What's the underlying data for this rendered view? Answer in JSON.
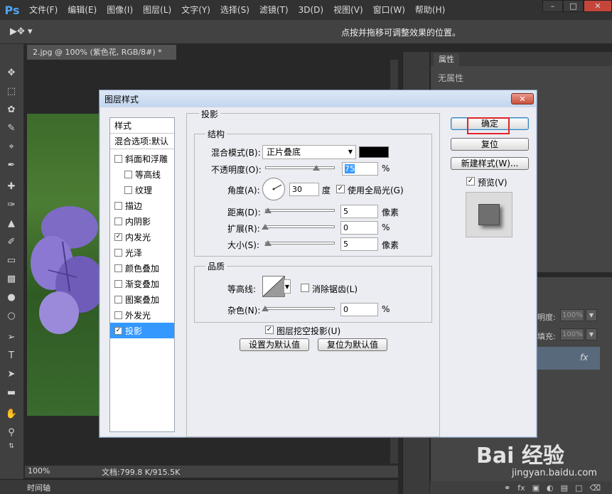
{
  "app": {
    "logo": "Ps"
  },
  "menu": [
    "文件(F)",
    "编辑(E)",
    "图像(I)",
    "图层(L)",
    "文字(Y)",
    "选择(S)",
    "滤镜(T)",
    "3D(D)",
    "视图(V)",
    "窗口(W)",
    "帮助(H)"
  ],
  "options_bar": {
    "hint": "点按并拖移可调整效果的位置。"
  },
  "document": {
    "tab_title": "2.jpg @ 100% (紫色花, RGB/8#) *",
    "zoom": "100%",
    "doc_size": "文档:799.8 K/915.5K",
    "timeline": "时间轴"
  },
  "properties_panel": {
    "tab": "属性",
    "empty_text": "无属性"
  },
  "layers_panel": {
    "opacity_label": "明度:",
    "opacity_value": "100%",
    "fill_label": "填充:",
    "fill_value": "100%",
    "fx_label": "fx"
  },
  "dialog": {
    "title": "图层样式",
    "style_list": [
      {
        "label": "样式",
        "type": "header"
      },
      {
        "label": "混合选项:默认",
        "type": "header"
      },
      {
        "label": "斜面和浮雕",
        "checked": false,
        "indent": false
      },
      {
        "label": "等高线",
        "checked": false,
        "indent": true
      },
      {
        "label": "纹理",
        "checked": false,
        "indent": true
      },
      {
        "label": "描边",
        "checked": false,
        "indent": false
      },
      {
        "label": "内阴影",
        "checked": false,
        "indent": false
      },
      {
        "label": "内发光",
        "checked": true,
        "indent": false
      },
      {
        "label": "光泽",
        "checked": false,
        "indent": false
      },
      {
        "label": "颜色叠加",
        "checked": false,
        "indent": false
      },
      {
        "label": "渐变叠加",
        "checked": false,
        "indent": false
      },
      {
        "label": "图案叠加",
        "checked": false,
        "indent": false
      },
      {
        "label": "外发光",
        "checked": false,
        "indent": false
      },
      {
        "label": "投影",
        "checked": true,
        "indent": false,
        "selected": true
      }
    ],
    "section_title": "投影",
    "structure": {
      "title": "结构",
      "blend_mode_label": "混合模式(B):",
      "blend_mode_value": "正片叠底",
      "shadow_color": "#000000",
      "opacity_label": "不透明度(O):",
      "opacity_value": "75",
      "opacity_percent": 75,
      "opacity_unit": "%",
      "angle_label": "角度(A):",
      "angle_value": "30",
      "angle_unit": "度",
      "global_light_label": "使用全局光(G)",
      "global_light_checked": true,
      "distance_label": "距离(D):",
      "distance_value": "5",
      "distance_unit": "像素",
      "spread_label": "扩展(R):",
      "spread_value": "0",
      "spread_unit": "%",
      "size_label": "大小(S):",
      "size_value": "5",
      "size_unit": "像素"
    },
    "quality": {
      "title": "品质",
      "contour_label": "等高线:",
      "antialias_label": "消除锯齿(L)",
      "antialias_checked": false,
      "noise_label": "杂色(N):",
      "noise_value": "0",
      "noise_unit": "%"
    },
    "knockout_label": "图层挖空投影(U)",
    "knockout_checked": true,
    "set_default_label": "设置为默认值",
    "reset_default_label": "复位为默认值",
    "ok_label": "确定",
    "reset_label": "复位",
    "new_style_label": "新建样式(W)...",
    "preview_label": "预览(V)",
    "preview_checked": true
  },
  "watermark": {
    "main": "Bai 经验",
    "url": "jingyan.baidu.com"
  },
  "colors": {
    "foreground": "#7b4ea8",
    "background": "#ffffff",
    "accent_selected": "#3399ff",
    "highlight_box": "#e0242a"
  }
}
